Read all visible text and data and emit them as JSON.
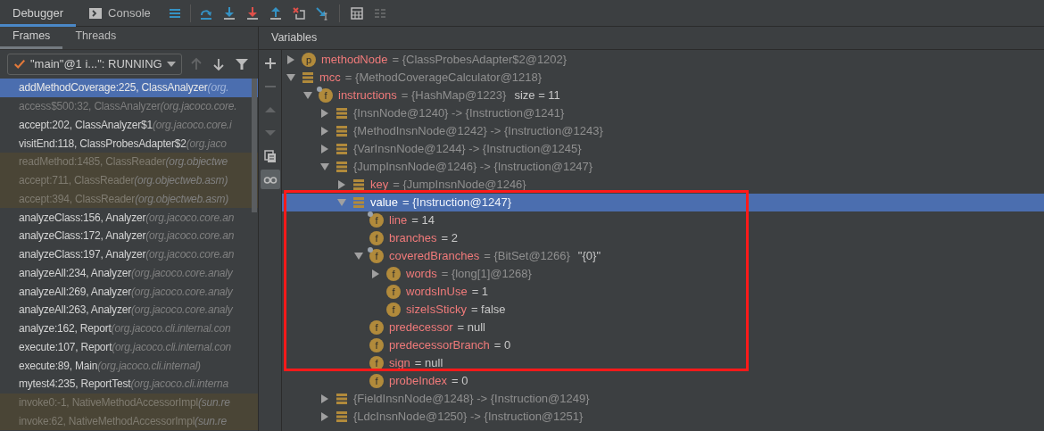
{
  "tabs": [
    {
      "label": "Debugger",
      "selected": true,
      "kind": "plain"
    },
    {
      "label": "Console",
      "selected": false,
      "kind": "console"
    }
  ],
  "actions": [
    {
      "kind": "frames-menu",
      "disabled": false
    },
    {
      "kind": "step-over",
      "disabled": false
    },
    {
      "kind": "step-into",
      "disabled": false
    },
    {
      "kind": "force-step-into",
      "disabled": false
    },
    {
      "kind": "step-out",
      "disabled": false
    },
    {
      "kind": "drop-frame",
      "disabled": false
    },
    {
      "kind": "run-to-cursor",
      "disabled": false
    },
    {
      "kind": "evaluate",
      "disabled": false
    },
    {
      "kind": "trace",
      "disabled": true
    }
  ],
  "frames_panel": {
    "tabs": [
      {
        "label": "Frames",
        "selected": true
      },
      {
        "label": "Threads",
        "selected": false
      }
    ],
    "thread": {
      "label": "\"main\"@1 i...\": RUNNING"
    },
    "nav": [
      {
        "kind": "up",
        "disabled": true
      },
      {
        "kind": "down",
        "disabled": false
      },
      {
        "kind": "filter",
        "disabled": false
      }
    ],
    "frames": [
      {
        "method": "addMethodCoverage:225, ClassAnalyzer",
        "package": "(org.",
        "kind": "normal",
        "selected": true
      },
      {
        "method": "access$500:32, ClassAnalyzer",
        "package": "(org.jacoco.core.",
        "kind": "dimmed",
        "selected": false
      },
      {
        "method": "accept:202, ClassAnalyzer$1",
        "package": "(org.jacoco.core.i",
        "kind": "normal",
        "selected": false
      },
      {
        "method": "visitEnd:118, ClassProbesAdapter$2",
        "package": "(org.jaco",
        "kind": "normal",
        "selected": false
      },
      {
        "method": "readMethod:1485, ClassReader",
        "package": "(org.objectwe",
        "kind": "library",
        "selected": false
      },
      {
        "method": "accept:711, ClassReader",
        "package": "(org.objectweb.asm)",
        "kind": "library",
        "selected": false
      },
      {
        "method": "accept:394, ClassReader",
        "package": "(org.objectweb.asm)",
        "kind": "library",
        "selected": false
      },
      {
        "method": "analyzeClass:156, Analyzer",
        "package": "(org.jacoco.core.an",
        "kind": "normal",
        "selected": false
      },
      {
        "method": "analyzeClass:172, Analyzer",
        "package": "(org.jacoco.core.an",
        "kind": "normal",
        "selected": false
      },
      {
        "method": "analyzeClass:197, Analyzer",
        "package": "(org.jacoco.core.an",
        "kind": "normal",
        "selected": false
      },
      {
        "method": "analyzeAll:234, Analyzer",
        "package": "(org.jacoco.core.analy",
        "kind": "normal",
        "selected": false
      },
      {
        "method": "analyzeAll:269, Analyzer",
        "package": "(org.jacoco.core.analy",
        "kind": "normal",
        "selected": false
      },
      {
        "method": "analyzeAll:263, Analyzer",
        "package": "(org.jacoco.core.analy",
        "kind": "normal",
        "selected": false
      },
      {
        "method": "analyze:162, Report",
        "package": "(org.jacoco.cli.internal.con",
        "kind": "normal",
        "selected": false
      },
      {
        "method": "execute:107, Report",
        "package": "(org.jacoco.cli.internal.con",
        "kind": "normal",
        "selected": false
      },
      {
        "method": "execute:89, Main",
        "package": "(org.jacoco.cli.internal)",
        "kind": "normal",
        "selected": false
      },
      {
        "method": "mytest4:235, ReportTest",
        "package": "(org.jacoco.cli.interna",
        "kind": "normal",
        "selected": false
      },
      {
        "method": "invoke0:-1, NativeMethodAccessorImpl",
        "package": "(sun.re",
        "kind": "library",
        "selected": false
      },
      {
        "method": "invoke:62, NativeMethodAccessorImpl",
        "package": "(sun.re",
        "kind": "library",
        "selected": false
      }
    ]
  },
  "variables_panel": {
    "title": "Variables",
    "tools": [
      {
        "kind": "add",
        "disabled": false
      },
      {
        "kind": "remove",
        "disabled": true
      },
      {
        "kind": "up",
        "disabled": true
      },
      {
        "kind": "down",
        "disabled": true
      },
      {
        "kind": "copy",
        "disabled": false
      },
      {
        "kind": "watches",
        "disabled": false,
        "on": true
      }
    ],
    "tree": [
      {
        "icon": {
          "kind": "badge",
          "letter": "p"
        },
        "name": "methodNode",
        "value": "= {ClassProbesAdapter$2@1202}",
        "kind": "ref",
        "expanded": false,
        "selected": false
      },
      {
        "icon": {
          "kind": "stack"
        },
        "name": "mcc",
        "value": "= {MethodCoverageCalculator@1218}",
        "kind": "ref",
        "expanded": true,
        "selected": false,
        "children": [
          {
            "icon": {
              "kind": "badge",
              "letter": "f",
              "overlay": true
            },
            "name": "instructions",
            "value": "= {HashMap@1223}",
            "kind": "ref",
            "extra": "size = 11",
            "expanded": true,
            "selected": false,
            "children": [
              {
                "icon": {
                  "kind": "stack"
                },
                "value": "{InsnNode@1240}  -> {Instruction@1241}",
                "kind": "ref",
                "expanded": false,
                "selected": false
              },
              {
                "icon": {
                  "kind": "stack"
                },
                "value": "{MethodInsnNode@1242}  -> {Instruction@1243}",
                "kind": "ref",
                "expanded": false,
                "selected": false
              },
              {
                "icon": {
                  "kind": "stack"
                },
                "value": "{VarInsnNode@1244}  -> {Instruction@1245}",
                "kind": "ref",
                "expanded": false,
                "selected": false
              },
              {
                "icon": {
                  "kind": "stack"
                },
                "value": "{JumpInsnNode@1246}  -> {Instruction@1247}",
                "kind": "ref",
                "expanded": true,
                "selected": false,
                "children": [
                  {
                    "icon": {
                      "kind": "stack"
                    },
                    "name": "key",
                    "value": "= {JumpInsnNode@1246}",
                    "kind": "ref",
                    "expanded": false,
                    "selected": false
                  },
                  {
                    "icon": {
                      "kind": "stack"
                    },
                    "name": "value",
                    "value": "= {Instruction@1247}",
                    "kind": "ref",
                    "expanded": true,
                    "selected": true,
                    "children": [
                      {
                        "icon": {
                          "kind": "badge",
                          "letter": "f",
                          "overlay": true
                        },
                        "name": "line",
                        "value": "= 14",
                        "kind": "primitive",
                        "selected": false
                      },
                      {
                        "icon": {
                          "kind": "badge",
                          "letter": "f"
                        },
                        "name": "branches",
                        "value": "= 2",
                        "kind": "primitive",
                        "selected": false
                      },
                      {
                        "icon": {
                          "kind": "badge",
                          "letter": "f",
                          "overlay": true
                        },
                        "name": "coveredBranches",
                        "value": "= {BitSet@1266}",
                        "kind": "ref",
                        "extra": "\"{0}\"",
                        "expanded": true,
                        "selected": false,
                        "children": [
                          {
                            "icon": {
                              "kind": "badge",
                              "letter": "f"
                            },
                            "name": "words",
                            "value": "= {long[1]@1268}",
                            "kind": "ref",
                            "expanded": false,
                            "selected": false
                          },
                          {
                            "icon": {
                              "kind": "badge",
                              "letter": "f"
                            },
                            "name": "wordsInUse",
                            "value": "= 1",
                            "kind": "primitive",
                            "selected": false
                          },
                          {
                            "icon": {
                              "kind": "badge",
                              "letter": "f"
                            },
                            "name": "sizeIsSticky",
                            "value": "= false",
                            "kind": "primitive",
                            "selected": false
                          }
                        ]
                      },
                      {
                        "icon": {
                          "kind": "badge",
                          "letter": "f"
                        },
                        "name": "predecessor",
                        "value": "= null",
                        "kind": "primitive",
                        "selected": false
                      },
                      {
                        "icon": {
                          "kind": "badge",
                          "letter": "f"
                        },
                        "name": "predecessorBranch",
                        "value": "= 0",
                        "kind": "primitive",
                        "selected": false
                      },
                      {
                        "icon": {
                          "kind": "badge",
                          "letter": "f"
                        },
                        "name": "sign",
                        "value": "= null",
                        "kind": "primitive",
                        "selected": false
                      },
                      {
                        "icon": {
                          "kind": "badge",
                          "letter": "f"
                        },
                        "name": "probeIndex",
                        "value": "= 0",
                        "kind": "primitive",
                        "selected": false
                      }
                    ]
                  }
                ]
              },
              {
                "icon": {
                  "kind": "stack"
                },
                "value": "{FieldInsnNode@1248}  -> {Instruction@1249}",
                "kind": "ref",
                "expanded": false,
                "selected": false
              },
              {
                "icon": {
                  "kind": "stack"
                },
                "value": "{LdcInsnNode@1250}  -> {Instruction@1251}",
                "kind": "ref",
                "expanded": false,
                "selected": false
              }
            ]
          }
        ]
      }
    ]
  }
}
